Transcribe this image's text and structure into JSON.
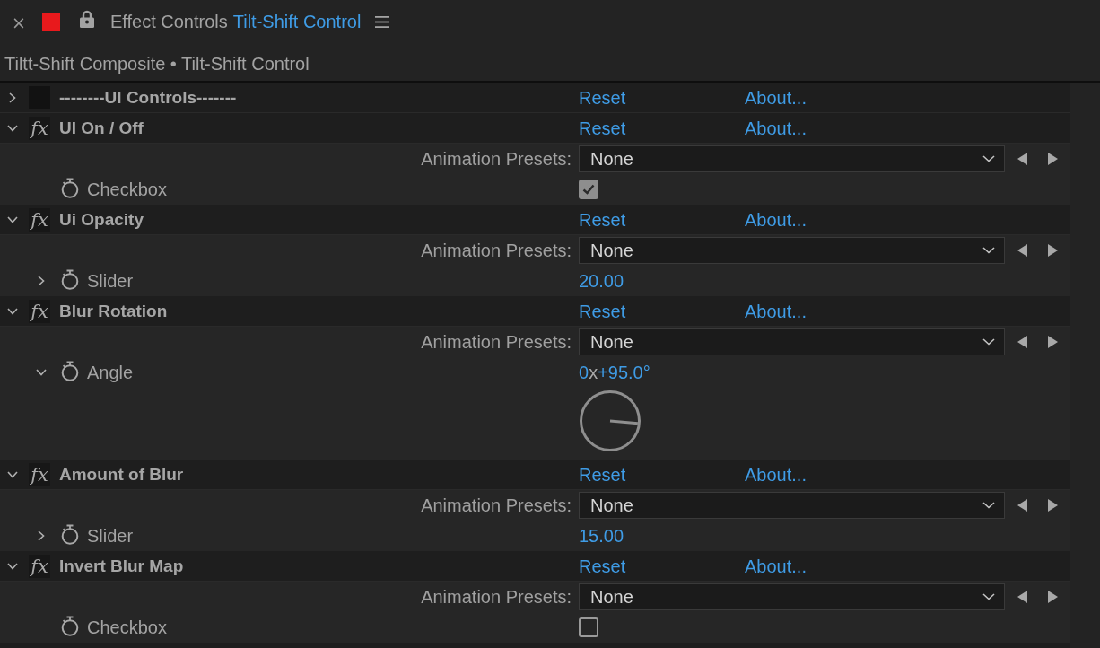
{
  "panel": {
    "close": "×",
    "title": "Effect Controls",
    "layer": "Tilt-Shift Control"
  },
  "breadcrumb": "Tiltt-Shift Composite • Tilt-Shift Control",
  "effects": [
    {
      "name": "--------UI Controls-------",
      "expanded": false,
      "reset": "Reset",
      "about": "About..."
    },
    {
      "name": "UI On / Off",
      "expanded": true,
      "fx": "fx",
      "reset": "Reset",
      "about": "About...",
      "presets": {
        "label": "Animation Presets:",
        "value": "None"
      },
      "properties": [
        {
          "kind": "checkbox",
          "name": "Checkbox",
          "checked": true
        }
      ]
    },
    {
      "name": "Ui Opacity",
      "expanded": true,
      "fx": "fx",
      "reset": "Reset",
      "about": "About...",
      "presets": {
        "label": "Animation Presets:",
        "value": "None"
      },
      "properties": [
        {
          "kind": "slider",
          "name": "Slider",
          "expanded": false,
          "value": "20.00"
        }
      ]
    },
    {
      "name": "Blur Rotation",
      "expanded": true,
      "fx": "fx",
      "reset": "Reset",
      "about": "About...",
      "presets": {
        "label": "Animation Presets:",
        "value": "None"
      },
      "properties": [
        {
          "kind": "angle",
          "name": "Angle",
          "expanded": true,
          "turns": "0",
          "turns_unit": "x",
          "degrees": "+95.0°"
        }
      ]
    },
    {
      "name": "Amount of Blur",
      "expanded": true,
      "fx": "fx",
      "reset": "Reset",
      "about": "About...",
      "presets": {
        "label": "Animation Presets:",
        "value": "None"
      },
      "properties": [
        {
          "kind": "slider",
          "name": "Slider",
          "expanded": false,
          "value": "15.00"
        }
      ]
    },
    {
      "name": "Invert Blur Map",
      "expanded": true,
      "fx": "fx",
      "reset": "Reset",
      "about": "About...",
      "presets": {
        "label": "Animation Presets:",
        "value": "None"
      },
      "properties": [
        {
          "kind": "checkbox",
          "name": "Checkbox",
          "checked": false
        }
      ]
    }
  ]
}
